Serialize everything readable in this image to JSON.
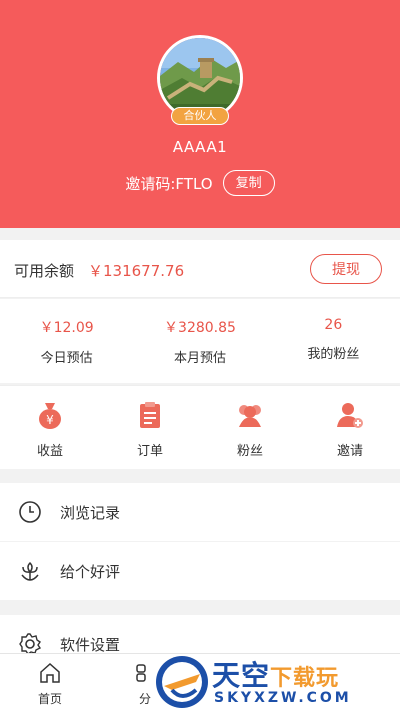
{
  "profile": {
    "badge": "合伙人",
    "username": "AAAA1",
    "invite_code": "邀请码:FTLO",
    "copy_label": "复制"
  },
  "balance": {
    "label": "可用余额",
    "value": "￥131677.76",
    "withdraw_label": "提现"
  },
  "stats": [
    {
      "value": "￥12.09",
      "label": "今日预估"
    },
    {
      "value": "￥3280.85",
      "label": "本月预估"
    },
    {
      "value": "26",
      "label": "我的粉丝"
    }
  ],
  "shortcuts": [
    {
      "label": "收益",
      "icon": "money-bag-icon"
    },
    {
      "label": "订单",
      "icon": "clipboard-icon"
    },
    {
      "label": "粉丝",
      "icon": "fans-icon"
    },
    {
      "label": "邀请",
      "icon": "invite-user-icon"
    }
  ],
  "menu": [
    {
      "label": "浏览记录",
      "icon": "clock-icon"
    },
    {
      "label": "给个好评",
      "icon": "flower-icon"
    },
    {
      "label": "软件设置",
      "icon": "gear-icon"
    }
  ],
  "tabbar": [
    {
      "label": "首页",
      "icon": "home-icon"
    },
    {
      "label": "分",
      "icon": "category-icon"
    }
  ],
  "watermark": {
    "title": "天空",
    "title_accent": "下载玩",
    "domain": "SKYXZW.COM"
  },
  "colors": {
    "header_bg": "#f55b5b",
    "accent": "#e8554a",
    "badge": "#f2a341"
  }
}
